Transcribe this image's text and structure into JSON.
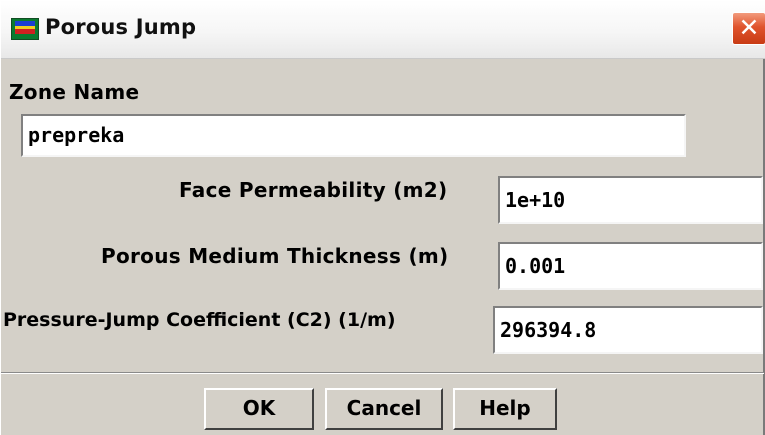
{
  "window": {
    "title": "Porous Jump",
    "close_symbol": "✕",
    "icon": "fluent-app-icon"
  },
  "form": {
    "zone_name": {
      "label": "Zone Name",
      "value": "prepreka"
    },
    "face_permeability": {
      "label": "Face Permeability (m2)",
      "value": "1e+10"
    },
    "porous_thickness": {
      "label": "Porous Medium Thickness (m)",
      "value": "0.001"
    },
    "pressure_jump": {
      "label": "Pressure-Jump Coefficient (C2) (1/m)",
      "value": "296394.8"
    }
  },
  "buttons": {
    "ok": "OK",
    "cancel": "Cancel",
    "help": "Help"
  },
  "colors": {
    "dialog_bg": "#d4d0c8",
    "close_button": "#e0542d"
  }
}
